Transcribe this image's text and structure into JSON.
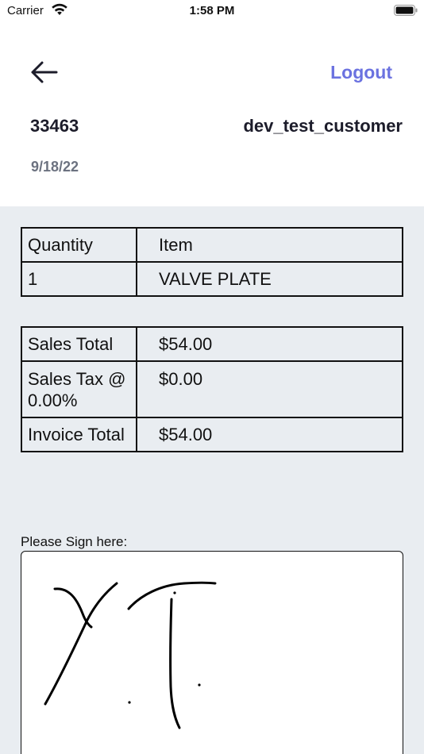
{
  "status_bar": {
    "carrier": "Carrier",
    "time": "1:58 PM"
  },
  "header": {
    "back_icon": "arrow-left-icon",
    "logout_label": "Logout",
    "invoice_number": "33463",
    "customer_name": "dev_test_customer",
    "date": "9/18/22"
  },
  "items_table": {
    "headers": [
      "Quantity",
      "Item"
    ],
    "rows": [
      {
        "quantity": "1",
        "item": "VALVE PLATE"
      }
    ]
  },
  "totals_table": {
    "rows": [
      {
        "label": "Sales Total",
        "value": "$54.00"
      },
      {
        "label": "Sales Tax @ 0.00%",
        "value": "$0.00"
      },
      {
        "label": "Invoice Total",
        "value": "$54.00"
      }
    ]
  },
  "signature": {
    "prompt": "Please Sign here:"
  },
  "colors": {
    "accent": "#6b72e0",
    "background": "#e9edf1",
    "header_bg": "#ffffff"
  }
}
